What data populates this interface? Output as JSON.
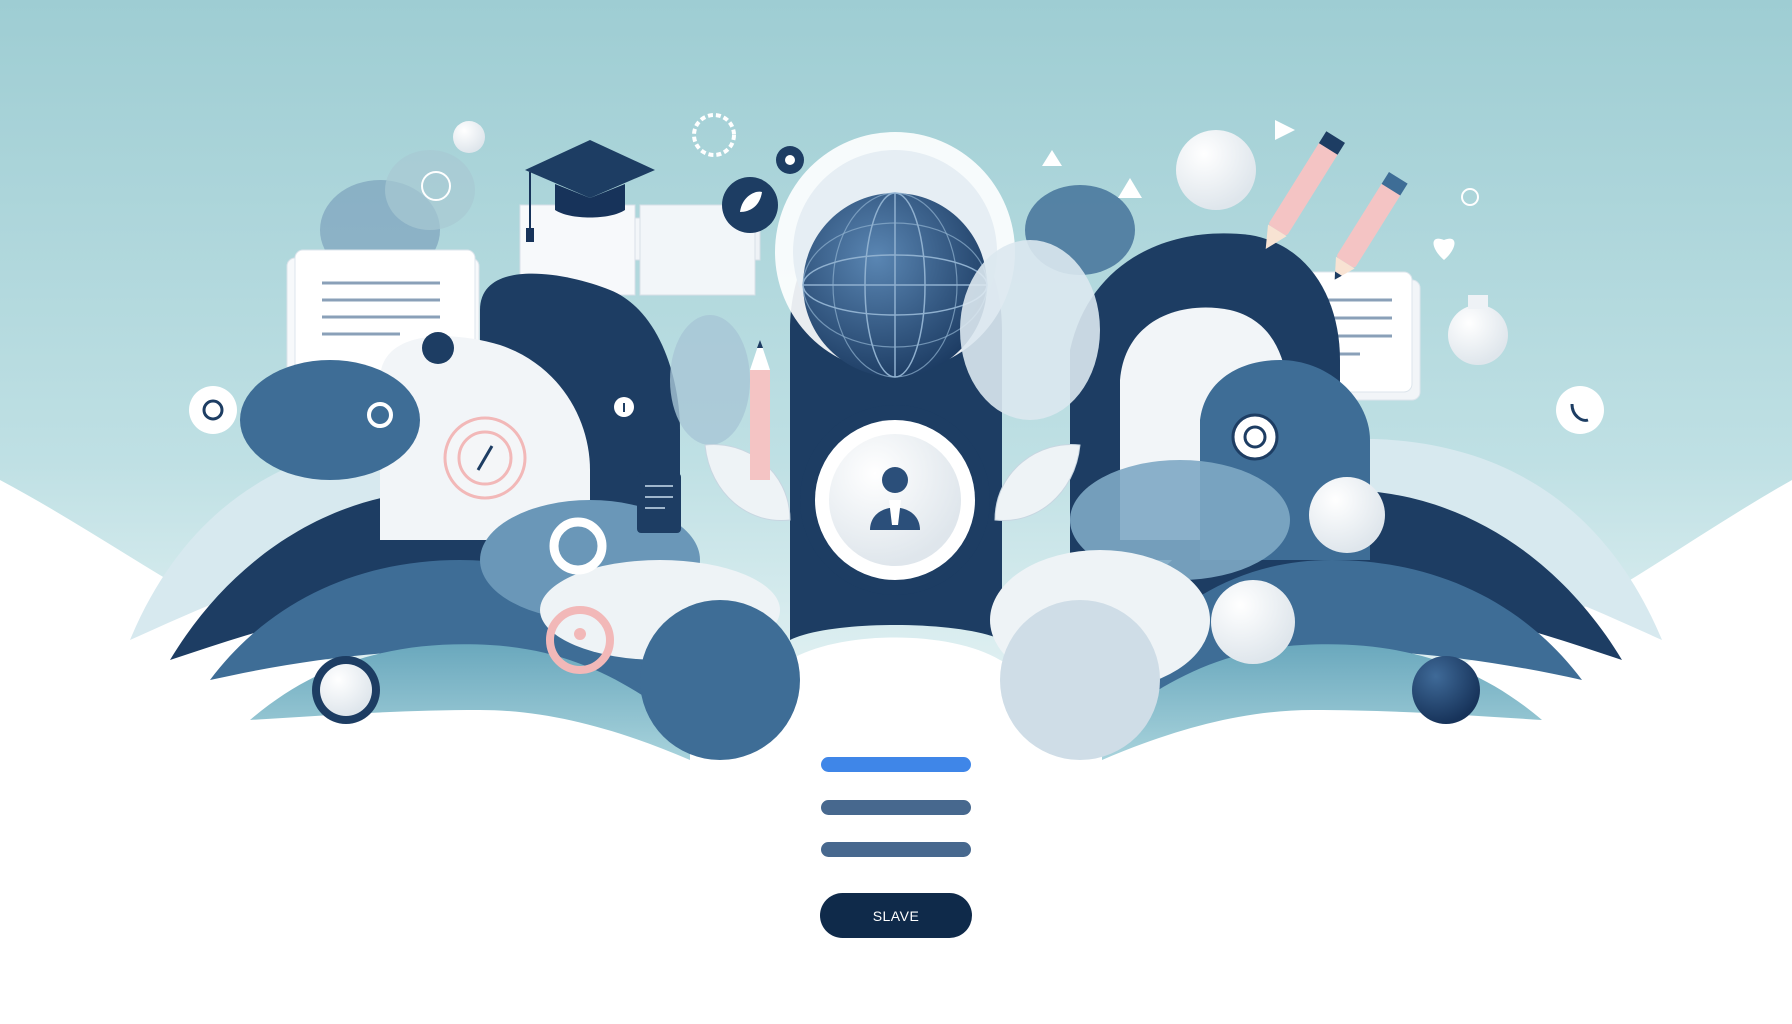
{
  "theme": {
    "navy": "#1d3d63",
    "mid_blue": "#3e6d96",
    "teal": "#86bdc8",
    "pale_teal": "#cfe6ea",
    "pink": "#f2b8b8",
    "white": "#ffffff"
  },
  "menu": {
    "bars": [
      {
        "color": "#3f86e8"
      },
      {
        "color": "#47688e"
      },
      {
        "color": "#47688e"
      }
    ]
  },
  "action_button": {
    "label": "SLAVE",
    "color": "#0f2a4a"
  }
}
